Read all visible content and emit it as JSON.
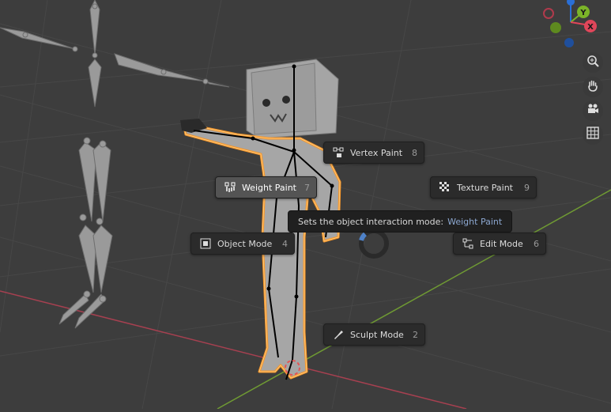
{
  "pie_menu": {
    "items": [
      {
        "id": "vertex_paint",
        "label": "Vertex Paint",
        "hotkey": "8",
        "icon": "vertex-paint-icon",
        "active": false
      },
      {
        "id": "weight_paint",
        "label": "Weight Paint",
        "hotkey": "7",
        "icon": "weight-paint-icon",
        "active": true
      },
      {
        "id": "texture_paint",
        "label": "Texture Paint",
        "hotkey": "9",
        "icon": "texture-paint-icon",
        "active": false
      },
      {
        "id": "object_mode",
        "label": "Object Mode",
        "hotkey": "4",
        "icon": "object-mode-icon",
        "active": false
      },
      {
        "id": "edit_mode",
        "label": "Edit Mode",
        "hotkey": "6",
        "icon": "edit-mode-icon",
        "active": false
      },
      {
        "id": "sculpt_mode",
        "label": "Sculpt Mode",
        "hotkey": "2",
        "icon": "sculpt-mode-icon",
        "active": false
      }
    ]
  },
  "tooltip": {
    "text": "Sets the object interaction mode:",
    "value": "Weight Paint"
  },
  "gizmo": {
    "axis_y": "Y",
    "axis_x": "X",
    "colors": {
      "x": "#e0465a",
      "y": "#7bb428",
      "z": "#2a6fd6"
    }
  },
  "navigation": {
    "buttons": [
      "zoom-icon",
      "hand-pan-icon",
      "camera-icon",
      "grid-icon"
    ]
  },
  "colors": {
    "background": "#3d3d3d",
    "selection_outline": "#f5962a",
    "axis_x_line": "#b04050",
    "axis_y_line": "#6f9a33"
  }
}
